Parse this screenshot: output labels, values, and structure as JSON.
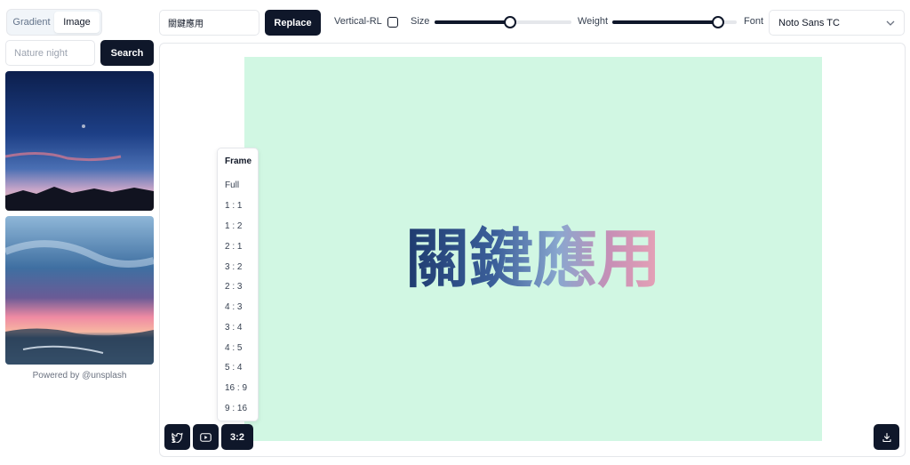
{
  "tabs": [
    "Gradient",
    "Image"
  ],
  "active_tab": "Image",
  "search": {
    "placeholder": "Nature night",
    "button": "Search"
  },
  "powered_by": "Powered by @unsplash",
  "toolbar": {
    "text_value": "關鍵應用",
    "replace_label": "Replace",
    "vertical_label": "Vertical-RL",
    "vertical_checked": false,
    "size_label": "Size",
    "size_value_fraction": 0.55,
    "weight_label": "Weight",
    "weight_value_fraction": 0.85,
    "font_label": "Font",
    "font_value": "Noto Sans TC"
  },
  "canvas": {
    "text": "關鍵應用",
    "background": "#d1f7e3"
  },
  "frame_menu": {
    "title": "Frame",
    "options": [
      "Full",
      "1 : 1",
      "1 : 2",
      "2 : 1",
      "3 : 2",
      "2 : 3",
      "4 : 3",
      "3 : 4",
      "4 : 5",
      "5 : 4",
      "16 : 9",
      "9 : 16"
    ]
  },
  "bottom_bar": {
    "twitter_icon": "twitter-icon",
    "youtube_icon": "youtube-icon",
    "ratio_label": "3:2",
    "download_icon": "download-icon"
  },
  "colors": {
    "accent": "#0f172a",
    "artboard": "#d1f7e3"
  }
}
